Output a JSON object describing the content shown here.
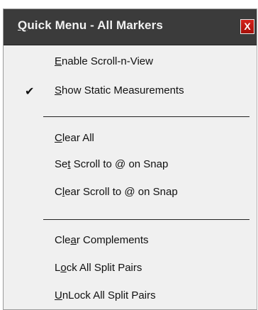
{
  "menu": {
    "title_accel": "Q",
    "title_rest": "uick Menu - All Markers",
    "close_label": "X",
    "items": [
      {
        "pre": "",
        "accel": "E",
        "post": "nable Scroll-n-View",
        "checked": false
      },
      {
        "pre": "",
        "accel": "S",
        "post": "how Static Measurements",
        "checked": true
      },
      {
        "pre": "",
        "accel": "C",
        "post": "lear All",
        "checked": false
      },
      {
        "pre": "Se",
        "accel": "t",
        "post": " Scroll to @ on Snap",
        "checked": false
      },
      {
        "pre": "C",
        "accel": "l",
        "post": "ear Scroll to @ on Snap",
        "checked": false
      },
      {
        "pre": "Cle",
        "accel": "a",
        "post": "r Complements",
        "checked": false
      },
      {
        "pre": "L",
        "accel": "o",
        "post": "ck All Split Pairs",
        "checked": false
      },
      {
        "pre": "",
        "accel": "U",
        "post": "nLock All Split Pairs",
        "checked": false
      }
    ],
    "check_mark": "✔"
  }
}
